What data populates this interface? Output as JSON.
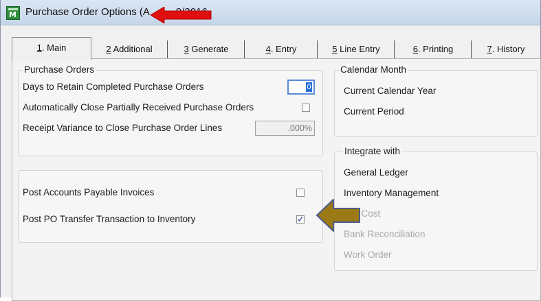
{
  "window": {
    "title": "Purchase Order Options (A",
    "title_suffix": "9/2016"
  },
  "tabs": [
    {
      "key": "1",
      "rest": ". Main"
    },
    {
      "key": "2",
      "rest": " Additional"
    },
    {
      "key": "3",
      "rest": " Generate"
    },
    {
      "key": "4",
      "rest": ". Entry"
    },
    {
      "key": "5",
      "rest": " Line Entry"
    },
    {
      "key": "6",
      "rest": ". Printing"
    },
    {
      "key": "7",
      "rest": ". History"
    }
  ],
  "purchase_orders": {
    "title": "Purchase Orders",
    "days_label": "Days to Retain Completed Purchase Orders",
    "days_value": "0",
    "auto_close_label": "Automatically Close Partially Received Purchase Orders",
    "auto_close_checked": false,
    "variance_label": "Receipt Variance to Close Purchase Order Lines",
    "variance_value": ".000%"
  },
  "posting": {
    "ap_invoices_label": "Post Accounts Payable Invoices",
    "ap_invoices_checked": false,
    "po_transfer_label": "Post PO Transfer Transaction to Inventory",
    "po_transfer_checked": true
  },
  "calendar": {
    "title": "Calendar Month",
    "year_label": "Current Calendar Year",
    "period_label": "Current Period"
  },
  "integrate": {
    "title": "Integrate with",
    "items": [
      {
        "label": "General Ledger",
        "enabled": true
      },
      {
        "label": "Inventory Management",
        "enabled": true
      },
      {
        "label": "Job Cost",
        "enabled": false
      },
      {
        "label": "Bank Reconciliation",
        "enabled": false
      },
      {
        "label": "Work Order",
        "enabled": false
      }
    ]
  },
  "colors": {
    "annotation_red": "#e01010",
    "annotation_gold": "#9b7a16"
  }
}
